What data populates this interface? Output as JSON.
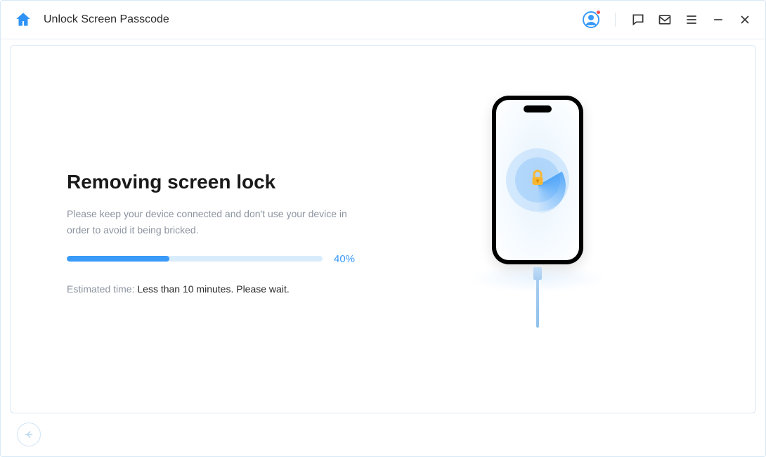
{
  "header": {
    "title": "Unlock Screen Passcode"
  },
  "main": {
    "heading": "Removing screen lock",
    "subtitle": "Please keep your device connected and don't use your device in order to avoid it being bricked.",
    "progress": {
      "percent_label": "40%",
      "percent_value": 40
    },
    "eta_label": "Estimated time: ",
    "eta_value": "Less than 10 minutes. Please wait."
  },
  "icons": {
    "home": "home-icon",
    "avatar": "avatar-icon",
    "chat": "chat-icon",
    "mail": "mail-icon",
    "menu": "menu-icon",
    "minimize": "minimize-icon",
    "close": "close-icon",
    "back": "back-icon",
    "lock": "lock-icon"
  },
  "colors": {
    "accent": "#3a9af8",
    "panel_border": "#dbe9f5",
    "text_muted": "#8c94a0"
  }
}
